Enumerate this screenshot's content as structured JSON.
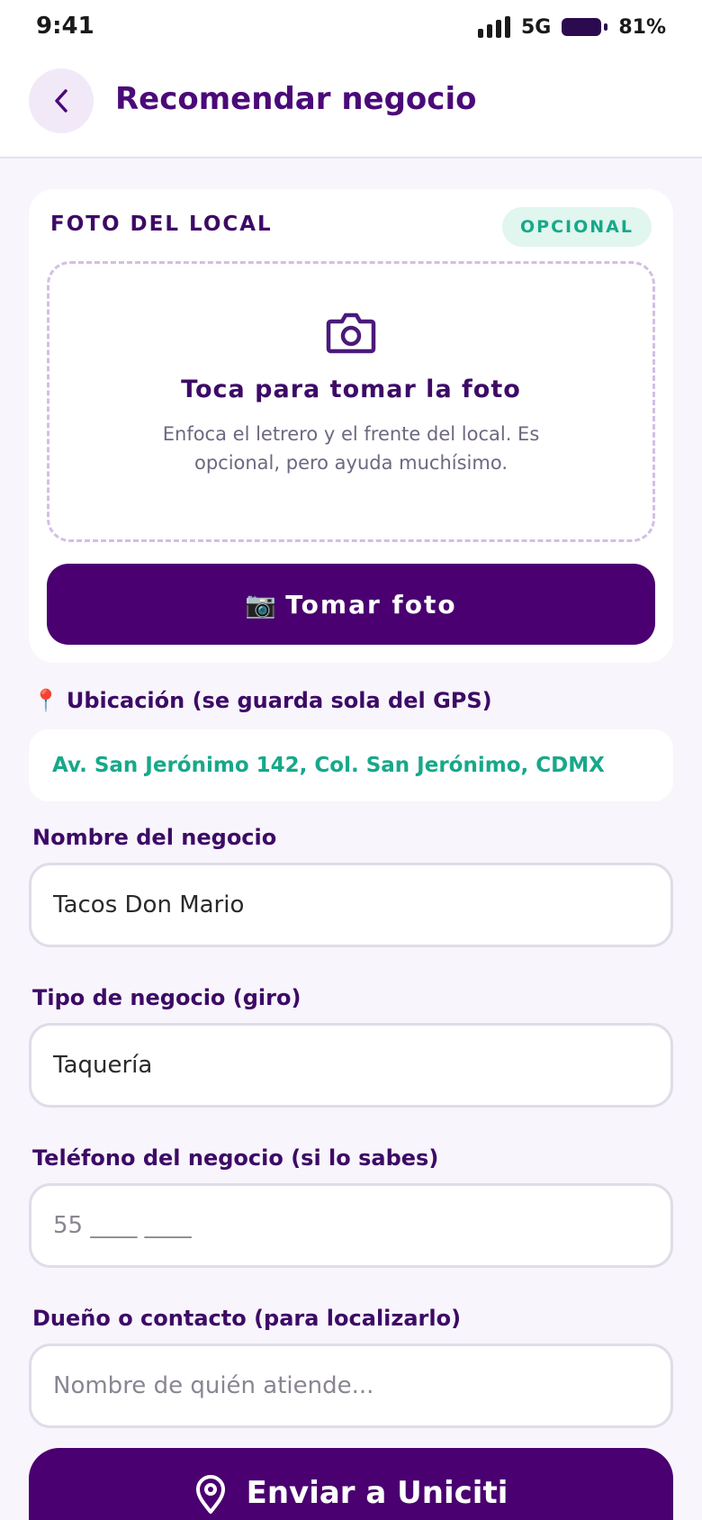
{
  "status_bar": {
    "time": "9:41",
    "network": "5G",
    "battery": "81%",
    "signal_icon": "signal-bars-icon",
    "battery_icon": "battery-icon"
  },
  "header": {
    "title": "Recomendar negocio",
    "back_icon": "chevron-left-icon"
  },
  "photo_card": {
    "label": "FOTO DEL LOCAL",
    "badge": "OPCIONAL",
    "dropzone_icon": "camera-icon",
    "dropzone_title": "Toca para tomar la foto",
    "dropzone_text": "Enfoca el letrero y el frente del local. Es opcional, pero ayuda muchísimo.",
    "button_icon": "📷",
    "button_label": "Tomar foto"
  },
  "location": {
    "icon": "📍",
    "label": "Ubicación (se guarda sola del GPS)",
    "value": "Av. San Jerónimo 142, Col. San Jerónimo, CDMX"
  },
  "fields": {
    "business_name": {
      "label": "Nombre del negocio",
      "value": "Tacos Don Mario",
      "placeholder": ""
    },
    "business_type": {
      "label": "Tipo de negocio (giro)",
      "value": "Taquería",
      "placeholder": ""
    },
    "phone": {
      "label": "Teléfono del negocio (si lo sabes)",
      "value": "",
      "placeholder": "55 ____ ____"
    },
    "contact": {
      "label": "Dueño o contacto (para localizarlo)",
      "value": "",
      "placeholder": "Nombre de quién atiende..."
    }
  },
  "submit": {
    "label": "Enviar a Uniciti",
    "icon": "map-pin-icon"
  },
  "colors": {
    "primary": "#4a0070",
    "accent": "#17a88a",
    "background": "#f8f5fc"
  }
}
